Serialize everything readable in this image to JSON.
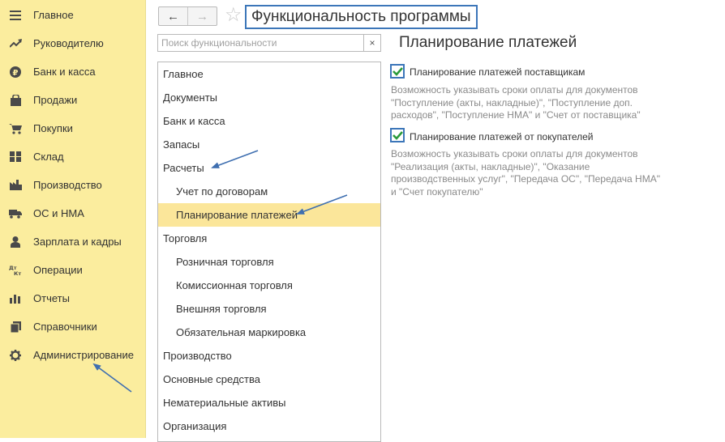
{
  "sidebar": {
    "items": [
      {
        "label": "Главное",
        "icon": "menu-icon"
      },
      {
        "label": "Руководителю",
        "icon": "trend-icon"
      },
      {
        "label": "Банк и касса",
        "icon": "coin-icon"
      },
      {
        "label": "Продажи",
        "icon": "bag-icon"
      },
      {
        "label": "Покупки",
        "icon": "cart-icon"
      },
      {
        "label": "Склад",
        "icon": "warehouse-icon"
      },
      {
        "label": "Производство",
        "icon": "factory-icon"
      },
      {
        "label": "ОС и НМА",
        "icon": "truck-icon"
      },
      {
        "label": "Зарплата и кадры",
        "icon": "person-icon"
      },
      {
        "label": "Операции",
        "icon": "dt-kt-icon"
      },
      {
        "label": "Отчеты",
        "icon": "bar-chart-icon"
      },
      {
        "label": "Справочники",
        "icon": "books-icon"
      },
      {
        "label": "Администрирование",
        "icon": "gear-icon"
      }
    ]
  },
  "toolbar": {
    "back": "←",
    "forward": "→",
    "star": "☆",
    "title": "Функциональность программы"
  },
  "search": {
    "placeholder": "Поиск функциональности",
    "clear": "×"
  },
  "tree": {
    "items": [
      {
        "label": "Главное",
        "level": 1
      },
      {
        "label": "Документы",
        "level": 1
      },
      {
        "label": "Банк и касса",
        "level": 1
      },
      {
        "label": "Запасы",
        "level": 1
      },
      {
        "label": "Расчеты",
        "level": 1
      },
      {
        "label": "Учет по договорам",
        "level": 2
      },
      {
        "label": "Планирование платежей",
        "level": 2,
        "selected": true
      },
      {
        "label": "Торговля",
        "level": 1
      },
      {
        "label": "Розничная торговля",
        "level": 2
      },
      {
        "label": "Комиссионная торговля",
        "level": 2
      },
      {
        "label": "Внешняя торговля",
        "level": 2
      },
      {
        "label": "Обязательная маркировка",
        "level": 2
      },
      {
        "label": "Производство",
        "level": 1
      },
      {
        "label": "Основные средства",
        "level": 1
      },
      {
        "label": "Нематериальные активы",
        "level": 1
      },
      {
        "label": "Организация",
        "level": 1
      }
    ]
  },
  "main": {
    "section_title": "Планирование платежей",
    "options": [
      {
        "label": "Планирование платежей поставщикам",
        "checked": true,
        "description": [
          "Возможность указывать сроки оплаты для документов",
          "\"Поступление (акты, накладные)\", \"Поступление доп.",
          "расходов\", \"Поступление НМА\" и \"Счет от поставщика\""
        ]
      },
      {
        "label": "Планирование платежей от покупателей",
        "checked": true,
        "description": [
          "Возможность указывать сроки оплаты для документов",
          "\"Реализация (акты, накладные)\", \"Оказание",
          "производственных услуг\", \"Передача ОС\", \"Передача НМА\"",
          "и \"Счет покупателю\""
        ]
      }
    ]
  },
  "colors": {
    "sidebar_bg": "#fbed9e",
    "selected_row": "#fbe69a",
    "highlight_border": "#3c76b9",
    "check_green": "#2a9a3a",
    "annotation_arrow": "#3f6fb0"
  }
}
